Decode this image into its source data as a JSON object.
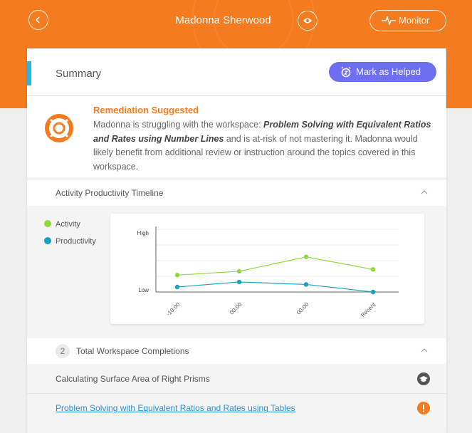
{
  "header": {
    "student_name": "Madonna Sherwood",
    "monitor_label": "Monitor",
    "bg_color": "#f47b20"
  },
  "summary": {
    "title": "Summary",
    "mark_helped_label": "Mark as Helped",
    "button_color": "#6e6ef0"
  },
  "remediation": {
    "heading": "Remediation Suggested",
    "text_before": "Madonna is struggling with the workspace: ",
    "workspace_name": "Problem Solving with Equivalent Ratios and Rates using Number Lines",
    "text_after": " and is at-risk of not mastering it. Madonna would likely benefit from additional review or instruction around the topics covered in this workspace."
  },
  "timeline": {
    "title": "Activity Productivity Timeline",
    "legend": [
      {
        "label": "Activity",
        "color": "#8ed83a"
      },
      {
        "label": "Productivity",
        "color": "#1a9fc4"
      }
    ]
  },
  "chart_data": {
    "type": "line",
    "categories": [
      "-10:00",
      "00:00",
      "00:00",
      "Recent"
    ],
    "y_tick_labels": [
      "High",
      "Low"
    ],
    "ylim": [
      0,
      1
    ],
    "grid": true,
    "series": [
      {
        "name": "Activity",
        "color": "#8ed83a",
        "values": [
          0.27,
          0.33,
          0.56,
          0.36
        ]
      },
      {
        "name": "Productivity",
        "color": "#1a9fc4",
        "values": [
          0.08,
          0.16,
          0.12,
          0.0
        ]
      }
    ]
  },
  "completions": {
    "count": "2",
    "title": "Total Workspace Completions",
    "items": [
      {
        "label": "Calculating Surface Area of Right Prisms",
        "icon": "graduation-cap-icon",
        "link": false
      },
      {
        "label": "Problem Solving with Equivalent Ratios and Rates using Tables",
        "icon": "exclamation-icon",
        "link": true
      }
    ]
  }
}
